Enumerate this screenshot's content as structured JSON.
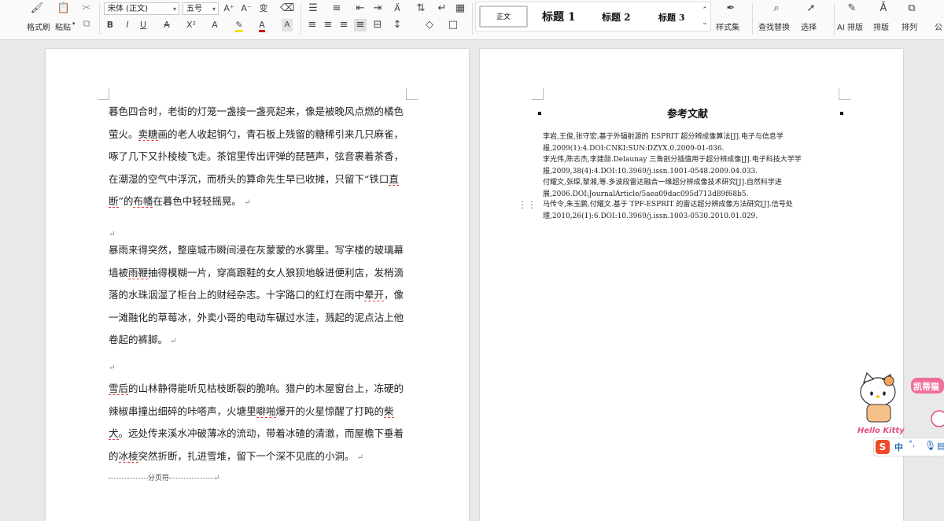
{
  "ribbon": {
    "format_painter": "格式刷",
    "paste": "粘贴",
    "font_name": "宋体 (正文)",
    "font_size": "五号",
    "styles": {
      "normal": "正文",
      "h1": "标题 1",
      "h2": "标题 2",
      "h3": "标题 3"
    },
    "style_set": "样式集",
    "find_replace": "查找替换",
    "select": "选择",
    "ai_layout": "AI 排版",
    "layout": "排版",
    "arrange": "排列",
    "more": "公"
  },
  "page1": {
    "paragraphs": [
      [
        {
          "t": "暮色四合时，老街的灯笼一盏接一盏亮起来，像是被晚风点燃的橘色萤火。"
        },
        {
          "t": "卖糖",
          "u": true
        },
        {
          "t": "画的老人收起铜勺，青石板上残留的糖稀引来几只麻雀，啄了几下又扑棱棱飞走。茶馆里传出评弹的琵琶声，弦音裹着茶香，在潮湿的空气中浮沉，而桥头的算命先生早已收摊，只留下“铁口"
        },
        {
          "t": "直断",
          "u": true
        },
        {
          "t": "”的"
        },
        {
          "t": "布幡",
          "u": true
        },
        {
          "t": "在暮色中轻轻摇晃。"
        }
      ],
      [
        {
          "t": "暴雨来得突然，整座城市瞬间浸在灰蒙蒙的水雾里。写字楼的玻璃幕墙被"
        },
        {
          "t": "雨鞭",
          "u": true
        },
        {
          "t": "抽得模糊一片，穿高跟鞋的女人狼狈地躲进便利店，发梢滴落的水珠洇湿了柜台上的财经杂志。十字路口的红灯在雨中"
        },
        {
          "t": "晕开",
          "u": true
        },
        {
          "t": "，像一滩融化的草莓冰，外卖小哥的电动车碾过水洼，溅起的泥点沾上他卷起的裤脚。"
        }
      ],
      [
        {
          "t": "雪后",
          "u": true
        },
        {
          "t": "的山林静得能听见枯枝断裂的脆响。猎户的木屋窗台上，冻硬的辣椒串撞出细碎的咔嗒声，火塘里"
        },
        {
          "t": "噼啪",
          "u": true
        },
        {
          "t": "爆开的火星惊醒了打盹的"
        },
        {
          "t": "柴犬",
          "u": true
        },
        {
          "t": "。远处传来溪水冲破薄冰的流动，带着冰碴的清澈，而屋檐下垂着的"
        },
        {
          "t": "冰棱",
          "u": true
        },
        {
          "t": "突然折断，扎进雪堆，留下一个深不见底的小洞。"
        }
      ]
    ],
    "page_break": "分页符"
  },
  "page2": {
    "title": "参考文献",
    "refs": [
      "李岩,王俊,张守宏.基于外辐射源的 ESPRIT 超分辨成像算法[J].电子与信息学报,2009(1):4.DOI:CNKI:SUN:DZYX.0.2009-01-036.",
      "李光伟,陈志杰,李建勋.Delaunay 三角剖分插值用于超分辨成像[J].电子科技大学学报,2009,38(4):4.DOI:10.3969/j.issn.1001-0548.2009.04.033.",
      "付耀文,张琛,黎湘,等.多波段雷达融合一维超分辨成像技术研究[J].自然科学进展,2006.DOI:JournalArticle/5aea09dac095d713d89f68b5.",
      "马传令,朱玉鹏,付耀文.基于 TPF-ESPRIT 的雷达超分辨成像方法研究[J].信号处理,2010,26(1):6.DOI:10.3969/j.issn.1003-0530.2010.01.029."
    ]
  },
  "overlay": {
    "brand": "Hello Kitty",
    "badge": "凯蒂猫",
    "ime_mode": "中",
    "ime_punct": "°,",
    "ime_logo": "S"
  },
  "colors": {
    "accent": "#2b579a",
    "misspell": "#e04040",
    "ribbon_bg": "#fafafa",
    "workspace": "#e9e9e9"
  }
}
